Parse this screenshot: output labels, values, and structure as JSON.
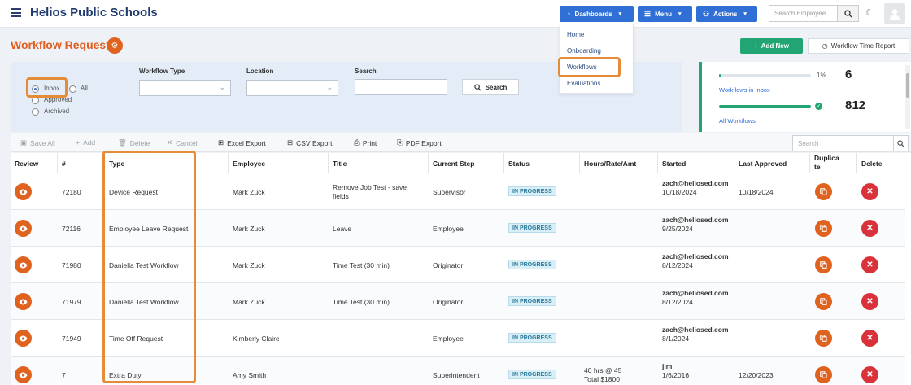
{
  "app": {
    "title": "Helios Public Schools"
  },
  "nav": {
    "dashboards": "Dashboards",
    "menu": "Menu",
    "actions": "Actions",
    "search_placeholder": "Search Employee..."
  },
  "dropdown": {
    "items": [
      "Home",
      "Onboarding",
      "Workflows",
      "Evaluations"
    ],
    "active": "Workflows"
  },
  "page": {
    "title": "Workflow Requests",
    "add_new": "Add New",
    "time_report": "Workflow Time Report"
  },
  "filter": {
    "radios": {
      "inbox": "Inbox",
      "all": "All",
      "approved": "Approved",
      "archived": "Archived"
    },
    "selected": "Inbox",
    "workflow_type_label": "Workflow Type",
    "location_label": "Location",
    "search_label": "Search",
    "search_button": "Search"
  },
  "stats": {
    "inbox": {
      "percent_label": "1%",
      "fraction": 0.01,
      "count": "6",
      "link": "Workflows in Inbox"
    },
    "all": {
      "fraction": 1.0,
      "count": "812",
      "link": "All Workflows"
    }
  },
  "toolbar": {
    "save_all": "Save All",
    "add": "Add",
    "delete": "Delete",
    "cancel": "Cancel",
    "excel": "Excel Export",
    "csv": "CSV Export",
    "print": "Print",
    "pdf": "PDF Export",
    "grid_search_placeholder": "Search"
  },
  "table": {
    "columns": [
      "Review",
      "#",
      "Type",
      "Employee",
      "Title",
      "Current Step",
      "Status",
      "Hours/Rate/Amt",
      "Started",
      "Last Approved",
      "Duplica\nte",
      "Delete"
    ],
    "rows": [
      {
        "id": "72180",
        "type": "Device Request",
        "employee": "Mark Zuck",
        "title": "Remove Job Test - save fields",
        "step": "Supervisor",
        "status": "IN PROGRESS",
        "hours": "",
        "started_by": "zach@heliosed.com",
        "started_date": "10/18/2024",
        "last_approved": "10/18/2024"
      },
      {
        "id": "72116",
        "type": "Employee Leave Request",
        "employee": "Mark Zuck",
        "title": "Leave",
        "step": "Employee",
        "status": "IN PROGRESS",
        "hours": "",
        "started_by": "zach@heliosed.com",
        "started_date": "9/25/2024",
        "last_approved": ""
      },
      {
        "id": "71980",
        "type": "Daniella Test Workflow",
        "employee": "Mark Zuck",
        "title": "Time Test (30 min)",
        "step": "Originator",
        "status": "IN PROGRESS",
        "hours": "",
        "started_by": "zach@heliosed.com",
        "started_date": "8/12/2024",
        "last_approved": ""
      },
      {
        "id": "71979",
        "type": "Daniella Test Workflow",
        "employee": "Mark Zuck",
        "title": "Time Test (30 min)",
        "step": "Originator",
        "status": "IN PROGRESS",
        "hours": "",
        "started_by": "zach@heliosed.com",
        "started_date": "8/12/2024",
        "last_approved": ""
      },
      {
        "id": "71949",
        "type": "Time Off Request",
        "employee": "Kimberly Claire",
        "title": "",
        "step": "Employee",
        "status": "IN PROGRESS",
        "hours": "",
        "started_by": "zach@heliosed.com",
        "started_date": "8/1/2024",
        "last_approved": ""
      },
      {
        "id": "7",
        "type": "Extra Duty",
        "employee": "Amy Smith",
        "title": "",
        "step": "Superintendent",
        "status": "IN PROGRESS",
        "hours": "40 hrs @ 45\nTotal $1800",
        "started_by": "jim",
        "started_date": "1/6/2016",
        "last_approved": "12/20/2023"
      }
    ]
  },
  "colors": {
    "brand_orange": "#e0621f",
    "primary_blue": "#2f6fd6",
    "success_green": "#22a572",
    "danger_red": "#d9323a",
    "highlight": "#e58c39"
  }
}
